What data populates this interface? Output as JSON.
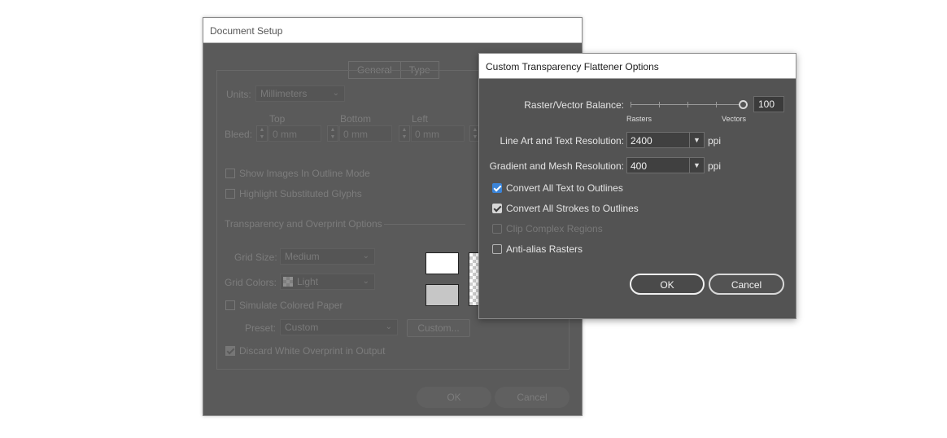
{
  "document_setup": {
    "title": "Document Setup",
    "tabs": [
      "General",
      "Type"
    ],
    "units_label": "Units:",
    "units_value": "Millimeters",
    "bleed_label": "Bleed:",
    "bleed_columns": [
      "Top",
      "Bottom",
      "Left"
    ],
    "bleed_values": [
      "0 mm",
      "0 mm",
      "0 mm"
    ],
    "show_images_outline": "Show Images In Outline Mode",
    "highlight_glyphs": "Highlight Substituted Glyphs",
    "transparency_section": "Transparency and Overprint Options",
    "grid_size_label": "Grid Size:",
    "grid_size_value": "Medium",
    "grid_colors_label": "Grid Colors:",
    "grid_colors_value": "Light",
    "simulate_paper": "Simulate Colored Paper",
    "preset_label": "Preset:",
    "preset_value": "Custom",
    "custom_button": "Custom...",
    "discard_overprint": "Discard White Overprint in Output",
    "discard_overprint_checked": true,
    "ok": "OK",
    "cancel": "Cancel"
  },
  "flattener": {
    "title": "Custom Transparency Flattener Options",
    "balance_label": "Raster/Vector Balance:",
    "balance_value": "100",
    "balance_fraction": 1.0,
    "rasters_label": "Rasters",
    "vectors_label": "Vectors",
    "line_art_label": "Line Art and Text Resolution:",
    "line_art_value": "2400",
    "gradient_label": "Gradient and Mesh Resolution:",
    "gradient_value": "400",
    "unit": "ppi",
    "checkboxes": [
      {
        "label": "Convert All Text to Outlines",
        "checked": true,
        "enabled": true
      },
      {
        "label": "Convert All Strokes to Outlines",
        "checked": true,
        "enabled": true
      },
      {
        "label": "Clip Complex Regions",
        "checked": false,
        "enabled": false
      },
      {
        "label": "Anti-alias Rasters",
        "checked": false,
        "enabled": true
      }
    ],
    "ok": "OK",
    "cancel": "Cancel"
  },
  "colors": {
    "dialog_bg": "#535353",
    "check_blue": "#3b84d8",
    "dimmed_bg": "#5a5a5a"
  }
}
